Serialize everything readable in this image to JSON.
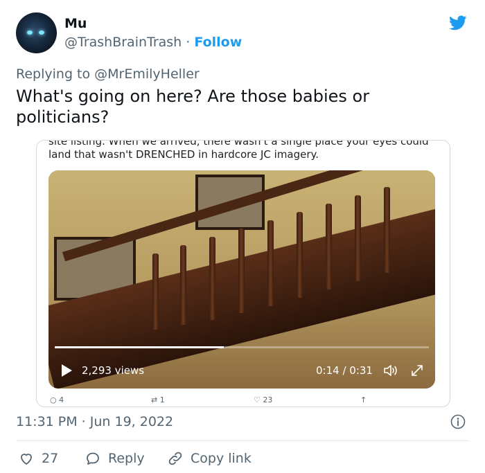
{
  "author": {
    "name": "Mu",
    "handle": "@TrashBrainTrash",
    "separator": "·",
    "follow_label": "Follow"
  },
  "replying_to": "Replying to @MrEmilyHeller",
  "tweet_text": "What's going on here? Are those babies or politicians?",
  "embed": {
    "cut_text": "site listing. When we arrived, there wasn't a single place your eyes could",
    "line_text": "land that wasn't DRENCHED in hardcore JC imagery.",
    "video": {
      "views": "2,293 views",
      "time": "0:14 / 0:31",
      "progress": 0.452
    },
    "actions": {
      "replies": "4",
      "retweets": "1",
      "likes": "23"
    }
  },
  "timestamp": "11:31 PM · Jun 19, 2022",
  "actions": {
    "likes": "27",
    "reply_label": "Reply",
    "copy_link_label": "Copy link"
  },
  "colors": {
    "twitter_blue": "#1d9bf0",
    "secondary_text": "#536471",
    "like_red": "#f91880"
  }
}
